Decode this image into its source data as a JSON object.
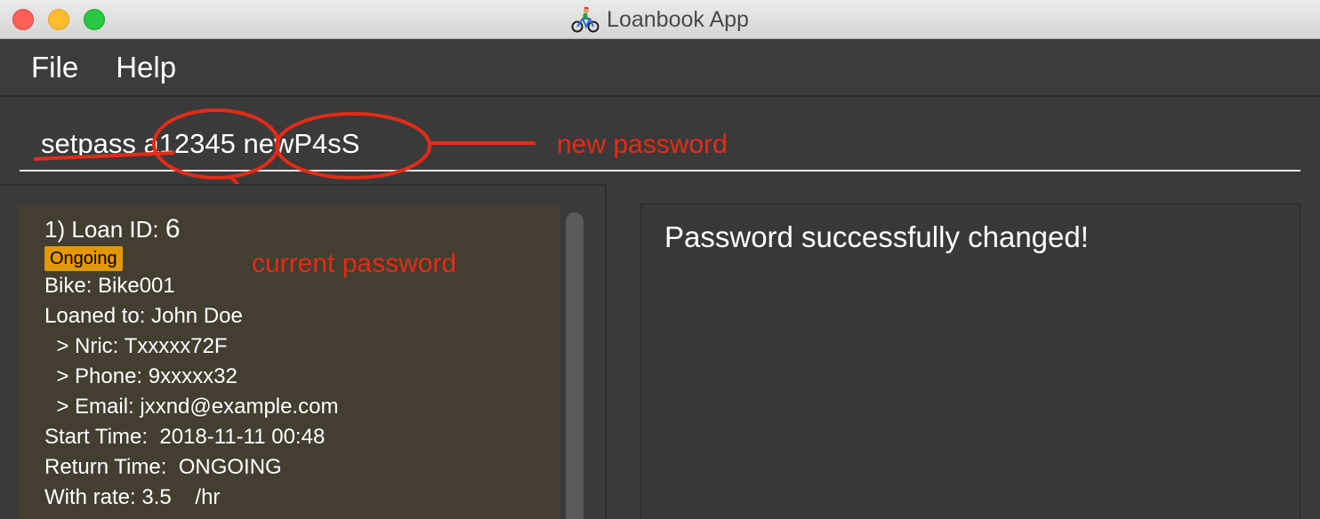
{
  "window": {
    "title": "Loanbook App"
  },
  "menu": {
    "items": [
      "File",
      "Help"
    ]
  },
  "command": {
    "value": "setpass a12345 newP4sS"
  },
  "annotations": {
    "new_password": "new password",
    "current_password": "current password"
  },
  "loan_list": {
    "cards": [
      {
        "index": "1)",
        "id_label": "Loan ID:",
        "id": "6",
        "status": "Ongoing",
        "bike": "Bike: Bike001",
        "loaned_to": "Loaned to: John Doe",
        "nric": "  > Nric: Txxxxx72F",
        "phone": "  > Phone: 9xxxxx32",
        "email": "  > Email: jxxnd@example.com",
        "start_time": "Start Time:  2018-11-11 00:48",
        "return_time": "Return Time:  ONGOING",
        "rate": "With rate: 3.5    /hr"
      }
    ]
  },
  "result": {
    "message": "Password successfully changed!"
  },
  "colors": {
    "annotation": "#e52b16",
    "status_ongoing": "#e29800",
    "card_bg": "#433e30"
  }
}
